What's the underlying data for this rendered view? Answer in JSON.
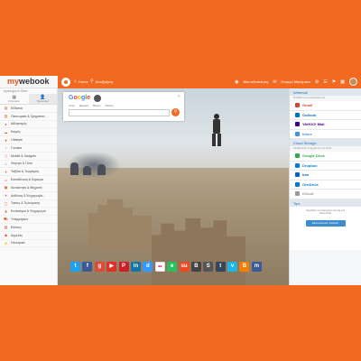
{
  "app": {
    "logo_prefix": "my",
    "logo_suffix": "webook"
  },
  "topbar": {
    "home_label": "Home",
    "search_label": "Αναζήτηση",
    "notifications_label": "Νέα ειδοποίηση",
    "messages_label": "Ενεργό Μηνύματα"
  },
  "sidebar": {
    "header": "Αγαπημένα Sites",
    "tabs": [
      {
        "icon": "grid-icon",
        "label": "Κατηγορίες"
      },
      {
        "icon": "user-icon",
        "label": "Προσωπικά"
      }
    ],
    "items": [
      {
        "label": "Ειδήσεις",
        "icon": "news-icon"
      },
      {
        "label": "Οικονομικά & Χρηματιστ...",
        "icon": "chart-icon"
      },
      {
        "label": "Αθλητισμός",
        "icon": "ball-icon"
      },
      {
        "label": "Καιρός",
        "icon": "cloud-icon"
      },
      {
        "label": "Lifestyle",
        "icon": "heart-icon"
      },
      {
        "label": "Γυναίκα",
        "icon": "female-icon"
      },
      {
        "label": "Mobile & Gadgets",
        "icon": "phone-icon"
      },
      {
        "label": "Φαγητό & Ποτό",
        "icon": "food-icon"
      },
      {
        "label": "Ταξίδια & Τουρισμός",
        "icon": "plane-icon"
      },
      {
        "label": "Εκπαίδευση & Καριέρα",
        "icon": "book-icon"
      },
      {
        "label": "Αυτοκίνητα & Μηχανές",
        "icon": "car-icon"
      },
      {
        "label": "Διάδοση & Ψυχαγωγία...",
        "icon": "ticket-icon"
      },
      {
        "label": "Ταινίες & Τηλεόραση",
        "icon": "tv-icon"
      },
      {
        "label": "Εστιατόρια & Ψυχαγωγία",
        "icon": "glass-icon"
      },
      {
        "label": "Υπερμάρκετ",
        "icon": "cart-icon"
      },
      {
        "label": "Εικόνες",
        "icon": "image-icon"
      },
      {
        "label": "Αγγελίες",
        "icon": "tag-icon"
      },
      {
        "label": "Ηλεκτρικά",
        "icon": "plug-icon"
      }
    ]
  },
  "google": {
    "logo": "Google",
    "tabs": [
      "Ιστός",
      "Εικόνες",
      "Βίντεο",
      "Χάρτες"
    ]
  },
  "social": [
    {
      "name": "twitter",
      "glyph": "t",
      "color": "#1da1f2"
    },
    {
      "name": "facebook",
      "glyph": "f",
      "color": "#3b5998"
    },
    {
      "name": "google-plus",
      "glyph": "g",
      "color": "#dd4b39"
    },
    {
      "name": "youtube",
      "glyph": "▶",
      "color": "#e52d27"
    },
    {
      "name": "pinterest",
      "glyph": "P",
      "color": "#cb2027"
    },
    {
      "name": "linkedin",
      "glyph": "in",
      "color": "#0e76a8"
    },
    {
      "name": "delicious",
      "glyph": "d",
      "color": "#3399ff"
    },
    {
      "name": "flickr",
      "glyph": "••",
      "color": "#ffffff"
    },
    {
      "name": "evernote",
      "glyph": "e",
      "color": "#2dbe60"
    },
    {
      "name": "stumbleupon",
      "glyph": "su",
      "color": "#eb4924"
    },
    {
      "name": "blogger",
      "glyph": "B",
      "color": "#444444"
    },
    {
      "name": "skype",
      "glyph": "S",
      "color": "#555555"
    },
    {
      "name": "tumblr",
      "glyph": "t",
      "color": "#35465c"
    },
    {
      "name": "vimeo",
      "glyph": "v",
      "color": "#1ab7ea"
    },
    {
      "name": "blogger-orange",
      "glyph": "B",
      "color": "#f57d00"
    },
    {
      "name": "myspace",
      "glyph": "m",
      "color": "#3a5a99"
    }
  ],
  "rpanel": {
    "webmail_title": "Webmail",
    "webmail_sub": "Συνδεθείτε στο λογαριασμό σας",
    "webmail": [
      {
        "label": "Gmail",
        "color": "#d44638"
      },
      {
        "label": "Outlook",
        "color": "#0072c6"
      },
      {
        "label": "YAHOO! Mail",
        "color": "#410093"
      },
      {
        "label": "Inbox",
        "color": "#4a90e2"
      }
    ],
    "cloud_title": "Cloud Storage",
    "cloud_sub": "Αποθηκεύστε τα αρχεία σας στο cloud",
    "cloud": [
      {
        "label": "Google Drive",
        "color": "#34a853"
      },
      {
        "label": "Dropbox",
        "color": "#007ee5"
      },
      {
        "label": "box",
        "color": "#0061d5"
      },
      {
        "label": "OneDrive",
        "color": "#0078d4"
      },
      {
        "label": "iCloud",
        "color": "#999999"
      }
    ],
    "tips_title": "Tips",
    "tips_text": "Προσθέστε τα αγαπημένα σας site στα Προσωπικά",
    "tips_button": "Εξατομίκευση Σελίδας"
  }
}
